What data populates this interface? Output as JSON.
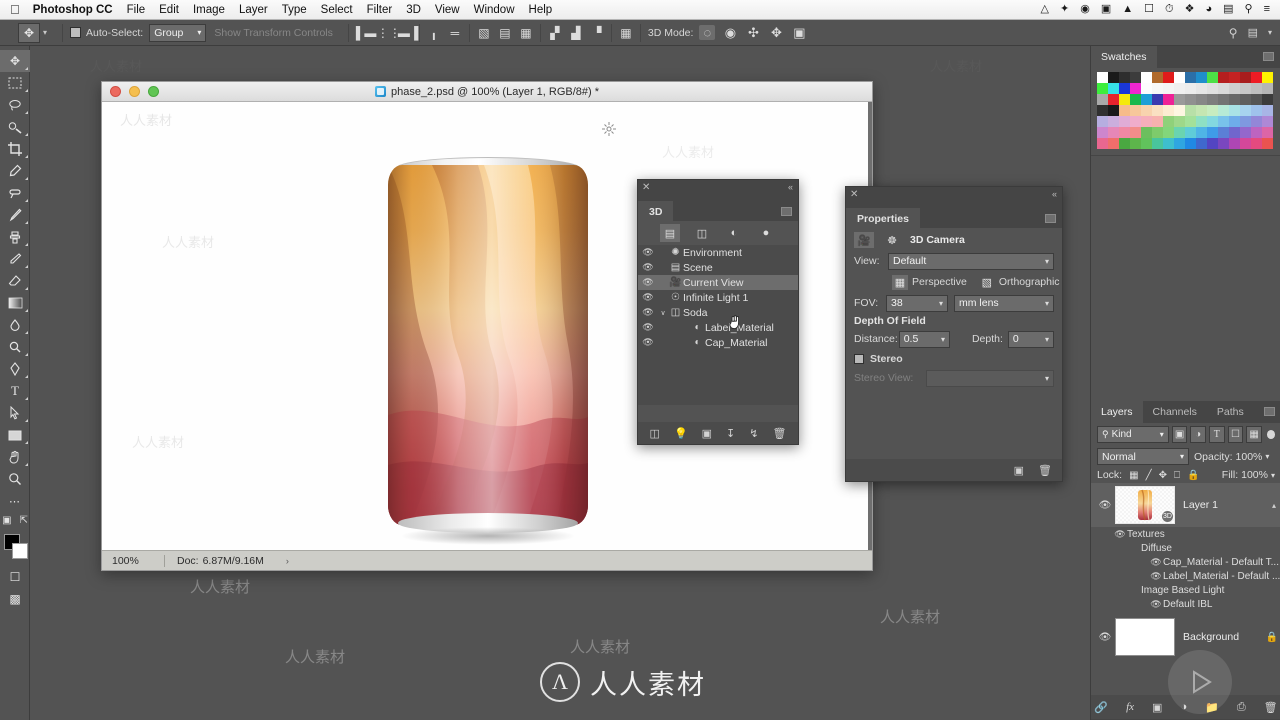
{
  "macmenu": {
    "apple_icon": "apple-icon",
    "app_name": "Photoshop CC",
    "items": [
      "File",
      "Edit",
      "Image",
      "Layer",
      "Type",
      "Select",
      "Filter",
      "3D",
      "View",
      "Window",
      "Help"
    ],
    "status_icons": [
      "google-drive-icon",
      "dropbox-icon",
      "creative-cloud-icon",
      "display-icon",
      "home-icon",
      "airplay-icon",
      "time-machine-icon",
      "bluetooth-icon",
      "wifi-icon",
      "battery-charging-icon",
      "spotlight-search-icon",
      "notification-center-icon"
    ]
  },
  "optionsbar": {
    "tool_icon": "move-tool-icon",
    "auto_select_label": "Auto-Select:",
    "auto_select_value": "Group",
    "show_transform_label": "Show Transform Controls",
    "align_icons": [
      "align-left-edges-icon",
      "align-horizontal-centers-icon",
      "align-right-edges-icon",
      "align-top-edges-icon",
      "align-vertical-centers-icon",
      "align-bottom-edges-icon"
    ],
    "distribute_icons": [
      "distribute-top-icon",
      "distribute-vertical-centers-icon",
      "distribute-bottom-icon",
      "distribute-left-icon",
      "distribute-horizontal-centers-icon",
      "distribute-right-icon",
      "auto-align-icon"
    ],
    "mode_3d_label": "3D Mode:",
    "mode_3d_icons": [
      "orbit-3d-icon",
      "roll-3d-icon",
      "pan-3d-icon",
      "slide-3d-icon",
      "zoom-3d-camera-icon"
    ],
    "right_icons": [
      "search-icon",
      "workspace-switcher-icon",
      "workspace-chevron-icon"
    ]
  },
  "toolbox": {
    "tools": [
      {
        "name": "move-tool",
        "glyph": "✥",
        "active": true
      },
      {
        "name": "rectangular-marquee-tool",
        "glyph": "marquee"
      },
      {
        "name": "lasso-tool",
        "glyph": "lasso"
      },
      {
        "name": "quick-selection-tool",
        "glyph": "quick-select"
      },
      {
        "name": "crop-tool",
        "glyph": "crop"
      },
      {
        "name": "eyedropper-tool",
        "glyph": "eyedropper"
      },
      {
        "name": "spot-healing-brush-tool",
        "glyph": "healing"
      },
      {
        "name": "brush-tool",
        "glyph": "brush"
      },
      {
        "name": "clone-stamp-tool",
        "glyph": "stamp"
      },
      {
        "name": "history-brush-tool",
        "glyph": "history-brush"
      },
      {
        "name": "eraser-tool",
        "glyph": "eraser"
      },
      {
        "name": "gradient-tool",
        "glyph": "gradient"
      },
      {
        "name": "blur-tool",
        "glyph": "blur"
      },
      {
        "name": "dodge-tool",
        "glyph": "dodge"
      },
      {
        "name": "pen-tool",
        "glyph": "pen"
      },
      {
        "name": "horizontal-type-tool",
        "glyph": "T"
      },
      {
        "name": "path-selection-tool",
        "glyph": "path-arrow"
      },
      {
        "name": "rectangle-tool",
        "glyph": "rectangle"
      },
      {
        "name": "hand-tool",
        "glyph": "hand"
      },
      {
        "name": "zoom-tool",
        "glyph": "zoom"
      },
      {
        "name": "edit-toolbar-tool",
        "glyph": "ellipsis"
      }
    ],
    "default_colors_icon": "default-colors-icon",
    "swap_colors_icon": "swap-colors-icon",
    "foreground_color": "#000000",
    "background_color": "#ffffff",
    "quick_mask_icon": "quick-mask-icon",
    "screen_mode_icon": "screen-mode-icon"
  },
  "document": {
    "title": "phase_2.psd @ 100% (Layer 1, RGB/8#) *",
    "file_icon": "psd-file-icon",
    "traffic_lights": [
      "close-button",
      "minimize-button",
      "zoom-button"
    ],
    "status": {
      "zoom": "100%",
      "doc_label": "Doc:",
      "doc_size": "6.87M/9.16M",
      "expand_arrow": "›"
    },
    "artwork": {
      "name": "soda-can-3d-render",
      "gizmo_icons": [
        "3d-rotate-icon",
        "3d-drag-icon",
        "3d-scale-icon"
      ],
      "axis_widget": "3d-axis-widget"
    }
  },
  "panel3d": {
    "close_icon": "close-icon",
    "collapse_icon": "collapse-icon",
    "tab_label": "3D",
    "menu_icon": "panel-menu-icon",
    "filters": [
      {
        "name": "scene-filter",
        "glyph": "☲",
        "selected": true
      },
      {
        "name": "mesh-filter",
        "glyph": "▣"
      },
      {
        "name": "materials-filter",
        "glyph": "◔"
      },
      {
        "name": "lights-filter",
        "glyph": "●"
      }
    ],
    "items": [
      {
        "label": "Environment",
        "icon": "environment-icon",
        "indent": 0,
        "selected": false,
        "disclosure": ""
      },
      {
        "label": "Scene",
        "icon": "scene-icon",
        "indent": 0,
        "selected": false,
        "disclosure": ""
      },
      {
        "label": "Current View",
        "icon": "camera-icon",
        "indent": 1,
        "selected": true,
        "disclosure": ""
      },
      {
        "label": "Infinite Light 1",
        "icon": "light-icon",
        "indent": 1,
        "selected": false,
        "disclosure": ""
      },
      {
        "label": "Soda",
        "icon": "mesh-icon",
        "indent": 1,
        "selected": false,
        "disclosure": "∨"
      },
      {
        "label": "Label_Material",
        "icon": "material-icon",
        "indent": 2,
        "selected": false,
        "disclosure": ""
      },
      {
        "label": "Cap_Material",
        "icon": "material-icon",
        "indent": 2,
        "selected": false,
        "disclosure": ""
      }
    ],
    "footer_icons": [
      "add-mesh-icon",
      "add-light-icon",
      "render-icon",
      "add-object-icon",
      "add-material-icon",
      "delete-icon"
    ]
  },
  "properties": {
    "close_icon": "close-icon",
    "collapse_icon": "collapse-icon",
    "tab_label": "Properties",
    "menu_icon": "panel-menu-icon",
    "header": {
      "camera_icon": "3d-camera-icon",
      "coordinates_icon": "coordinates-icon",
      "title": "3D Camera"
    },
    "view_label": "View:",
    "view_value": "Default",
    "projection": {
      "perspective_label": "Perspective",
      "perspective_icon": "perspective-icon",
      "orthographic_label": "Orthographic",
      "orthographic_icon": "orthographic-icon",
      "selected": "Perspective"
    },
    "fov_label": "FOV:",
    "fov_value": "38",
    "fov_unit": "mm lens",
    "dof_header": "Depth Of Field",
    "distance_label": "Distance:",
    "distance_value": "0.5",
    "depth_label": "Depth:",
    "depth_value": "0",
    "stereo_label": "Stereo",
    "stereo_checked": false,
    "stereo_view_label": "Stereo View:",
    "stereo_view_value": "",
    "footer_icons": [
      "render-settings-icon",
      "delete-icon"
    ]
  },
  "swatches": {
    "tab_label": "Swatches",
    "menu_icon": "panel-menu-icon",
    "colors": [
      "#ffffff",
      "#1a1a1a",
      "#2e2e2e",
      "#3c3c3c",
      "#ffffff",
      "#b06a2c",
      "#e01b1b",
      "#ffffff",
      "#2b6fa8",
      "#1f8ecb",
      "#4ce046",
      "#b51e1e",
      "#c42222",
      "#a81d1d",
      "#ee1c24",
      "#fff200",
      "#3ded3d",
      "#36e0e8",
      "#1a37d6",
      "#ef26d0",
      "#fdfdfd",
      "#f7f7f7",
      "#f4f4f4",
      "#f0f0f0",
      "#ececec",
      "#e6e6e6",
      "#e0e0e0",
      "#d9d9d9",
      "#cfcfcf",
      "#c7c7c7",
      "#bfbfbf",
      "#b5b5b5",
      "#a9a9a9",
      "#e8232c",
      "#f5e90a",
      "#1ab84c",
      "#1e9fd6",
      "#3a3ab0",
      "#ef2196",
      "#9a9a9a",
      "#909090",
      "#878787",
      "#7d7d7d",
      "#737373",
      "#696969",
      "#5f5f5f",
      "#555555",
      "#3c3c3c",
      "#303030",
      "#1a1a1a",
      "#f6bb8a",
      "#f7c79b",
      "#f8d3ae",
      "#fae0c2",
      "#fcecd2",
      "#fdf6e2",
      "#b8e0a8",
      "#c5e6b2",
      "#c8ecc0",
      "#b7ead6",
      "#a9e3e6",
      "#a7d3ef",
      "#9fc2ec",
      "#a8b5e6",
      "#b6aee0",
      "#cbaedd",
      "#e0acd6",
      "#f0adcb",
      "#f6aebb",
      "#f7b1ae",
      "#8fd17a",
      "#9ed88a",
      "#a3e19a",
      "#8ee0c4",
      "#83d8e0",
      "#79c2eb",
      "#6eadea",
      "#7f99e0",
      "#9387d8",
      "#ae88d6",
      "#cd86cd",
      "#e687b7",
      "#f088a3",
      "#f38d8a",
      "#6cbf5e",
      "#7ecb6b",
      "#83d67b",
      "#6ad4b0",
      "#5fccd8",
      "#4fb4e6",
      "#3f9be8",
      "#5b7fd6",
      "#7166cd",
      "#9467cc",
      "#bd64c0",
      "#dc65a6",
      "#e96790",
      "#ef6e6b",
      "#4aa841",
      "#5db54b",
      "#61c25c",
      "#49c59c",
      "#3ebfcd",
      "#2fa6e0",
      "#2089e3",
      "#3f68cd",
      "#5345c2",
      "#7a47bf",
      "#ae46b4",
      "#d4479a",
      "#e44a7f",
      "#eb5350"
    ]
  },
  "layers": {
    "tabs": [
      {
        "label": "Layers",
        "selected": true
      },
      {
        "label": "Channels",
        "selected": false
      },
      {
        "label": "Paths",
        "selected": false
      }
    ],
    "menu_icon": "panel-menu-icon",
    "filter": {
      "kind_label": "Kind",
      "search_icon": "filter-search-icon",
      "type_icons": [
        "filter-pixel-icon",
        "filter-adjustment-icon",
        "filter-type-icon",
        "filter-shape-icon",
        "filter-smart-object-icon"
      ],
      "toggle_icon": "filter-toggle-icon"
    },
    "blend_mode": "Normal",
    "opacity_label": "Opacity:",
    "opacity_value": "100%",
    "lock_label": "Lock:",
    "lock_icons": [
      "lock-transparent-pixels-icon",
      "lock-image-pixels-icon",
      "lock-position-icon",
      "lock-artboard-nesting-icon",
      "lock-all-icon"
    ],
    "fill_label": "Fill:",
    "fill_value": "100%",
    "items": [
      {
        "name": "Layer 1",
        "type": "3d-layer",
        "selected": true,
        "visible": true,
        "expanded": true,
        "badge": "3d-badge-icon",
        "chevron": "⌃"
      },
      {
        "name": "Textures",
        "type": "subgroup",
        "visible": true,
        "indent": 1
      },
      {
        "name": "Diffuse",
        "type": "label",
        "indent": 2
      },
      {
        "name": "Cap_Material - Default T...",
        "type": "texture",
        "visible": true,
        "indent": 3
      },
      {
        "name": "Label_Material - Default ...",
        "type": "texture",
        "visible": true,
        "indent": 3
      },
      {
        "name": "Image Based Light",
        "type": "label",
        "indent": 2
      },
      {
        "name": "Default IBL",
        "type": "texture",
        "visible": true,
        "indent": 3
      },
      {
        "name": "Background",
        "type": "background",
        "visible": true,
        "locked": true,
        "lock_icon": "lock-icon"
      }
    ],
    "footer_icons": [
      "link-layers-icon",
      "layer-style-fx-icon",
      "layer-mask-icon",
      "adjustment-layer-icon",
      "new-group-icon",
      "new-layer-icon",
      "delete-layer-icon"
    ]
  },
  "watermarks": {
    "text": "人人素材",
    "brand": "人人素材",
    "logo_glyph": "Λ"
  }
}
